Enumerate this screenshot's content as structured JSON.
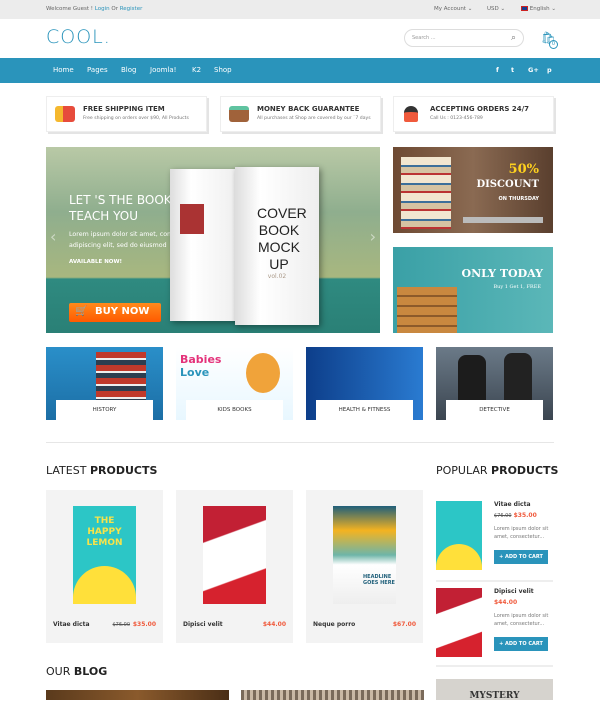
{
  "topbar": {
    "welcome": "Welcome Guest !",
    "login": "Login",
    "or": "Or",
    "register": "Register",
    "account": "My Account ⌄",
    "currency": "USD ⌄",
    "language": "English ⌄"
  },
  "header": {
    "logo": "COOL.",
    "search_placeholder": "Search ...",
    "cart_count": "0"
  },
  "nav": {
    "items": [
      "Home",
      "Pages",
      "Blog",
      "Joomla!",
      "K2",
      "Shop"
    ],
    "social": [
      "f",
      "t",
      "G+",
      "p"
    ]
  },
  "features": [
    {
      "title": "FREE SHIPPING ITEM",
      "sub": "Free shipping on orders over $90, All Products",
      "icon": "truck-icon",
      "color": "#e74c3c"
    },
    {
      "title": "MONEY BACK GUARANTEE",
      "sub": "All purchases at Shop are covered by our `7 days",
      "icon": "wallet-icon",
      "color": "#a0623a"
    },
    {
      "title": "ACCEPTING ORDERS 24/7",
      "sub": "Call Us : 0123-456-789",
      "icon": "support-agent-icon",
      "color": "#f05a3c"
    }
  ],
  "hero": {
    "title_line1": "LET 'S THE BOOKS",
    "title_line2": "TEACH YOU",
    "text_line1": "Lorem ipsum dolor sit amet, consectetur",
    "text_line2": "adipiscing elit, sed do eiusmod",
    "available": "AVAILABLE NOW!",
    "buy": "BUY NOW",
    "book_title": "COVER BOOK MOCK UP",
    "book_vol": "vol.02"
  },
  "banners": [
    {
      "big": "50%",
      "title": "DISCOUNT",
      "sub": "ON THURSDAY"
    },
    {
      "title": "ONLY TODAY",
      "sub": "Buy 1 Get 1, FREE"
    }
  ],
  "categories": [
    "HISTORY",
    "KIDS BOOKS",
    "HEALTH & FITNESS",
    "DETECTIVE"
  ],
  "latest": {
    "light": "LATEST",
    "bold": "PRODUCTS",
    "items": [
      {
        "name": "Vitae dicta",
        "old": "$76.00",
        "price": "$35.00",
        "cover": "THE HAPPY LEMON"
      },
      {
        "name": "Dipisci velit",
        "old": "",
        "price": "$44.00"
      },
      {
        "name": "Neque porro",
        "old": "",
        "price": "$67.00",
        "cover": "HEADLINE GOES HERE"
      }
    ]
  },
  "popular": {
    "light": "POPULAR",
    "bold": "PRODUCTS",
    "add": "+ ADD TO CART",
    "items": [
      {
        "name": "Vitae dicta",
        "old": "$76.00",
        "price": "$35.00",
        "desc1": "Lorem ipsum dolor sit",
        "desc2": "amet, consectetur..."
      },
      {
        "name": "Dipisci velit",
        "old": "",
        "price": "$44.00",
        "desc1": "Lorem ipsum dolor sit",
        "desc2": "amet, consectetur..."
      }
    ]
  },
  "blog": {
    "light": "OUR",
    "bold": "BLOG",
    "side_banner": "MYSTERY"
  },
  "colors": {
    "accent": "#2a94bb",
    "price": "#f05a3c",
    "buy": "#ff6a00"
  }
}
